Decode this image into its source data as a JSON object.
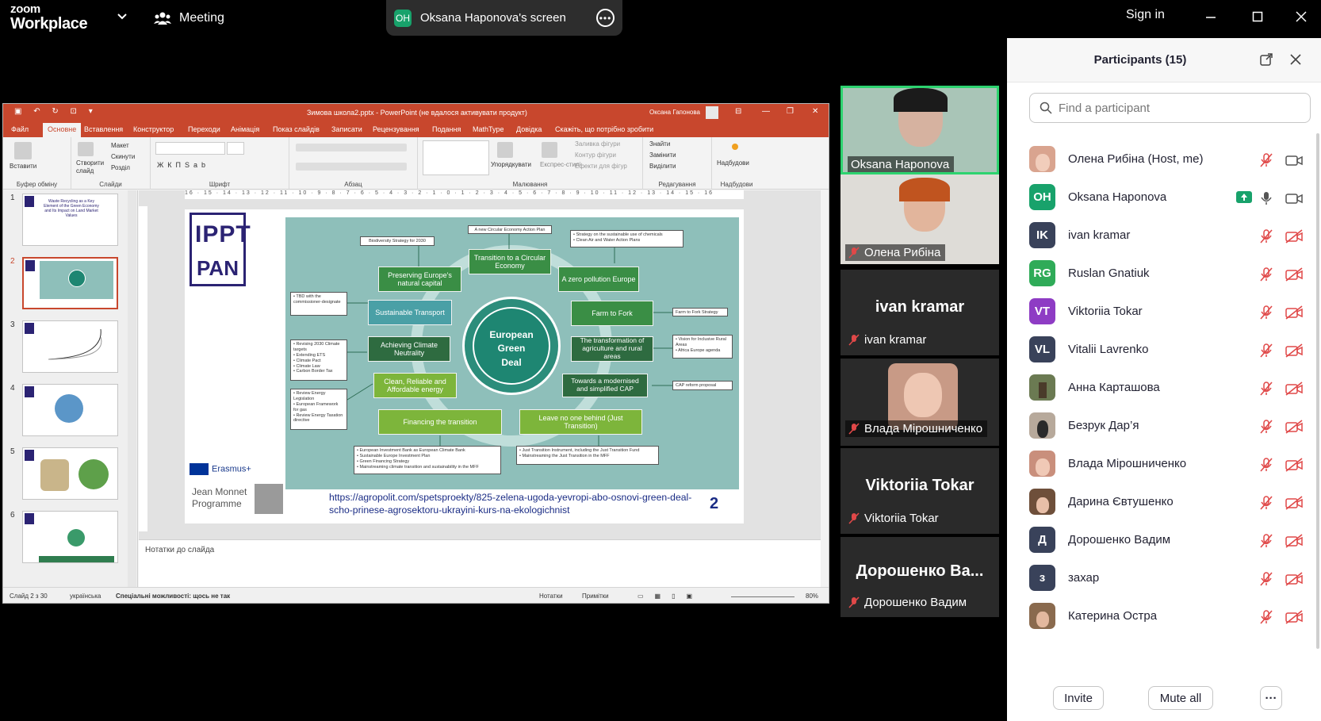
{
  "app": {
    "logo_line1": "zoom",
    "logo_line2": "Workplace",
    "meeting_label": "Meeting",
    "share_initials": "OH",
    "share_title": "Oksana Haponova's screen",
    "sign_in": "Sign in"
  },
  "ppt": {
    "window_title": "Зимова школа2.pptx - PowerPoint (не вдалося активувати продукт)",
    "user": "Оксана Гапонова",
    "tabs": [
      "Файл",
      "Основне",
      "Вставлення",
      "Конструктор",
      "Переходи",
      "Анімація",
      "Показ слайдів",
      "Записати",
      "Рецензування",
      "Подання",
      "MathType",
      "Довідка",
      "Скажіть, що потрібно зробити"
    ],
    "ribbon": {
      "paste": "Вставити",
      "clipboard": "Буфер обміну",
      "new_slide": "Створити слайд",
      "layout": "Макет",
      "reset": "Скинути",
      "section": "Розділ",
      "slides": "Слайди",
      "font": "Шрифт",
      "paragraph": "Абзац",
      "arrange": "Упорядкувати",
      "quick_styles": "Експрес-стилі",
      "shape_fill": "Заливка фігури",
      "shape_outline": "Контур фігури",
      "shape_effects": "Ефекти для фігур",
      "drawing": "Малювання",
      "find": "Знайти",
      "replace": "Замінити",
      "select": "Виділити",
      "editing": "Редагування",
      "addins_btn": "Надбудови",
      "addins": "Надбудови"
    },
    "ruler": "16 · 15 · 14 · 13 · 12 · 11 · 10 · 9 · 8 · 7 · 6 · 5 · 4 · 3 · 2 · 1 · 0 · 1 · 2 · 3 · 4 · 5 · 6 · 7 · 8 · 9 · 10 · 11 · 12 · 13 · 14 · 15 · 16",
    "thumb_numbers": [
      "1",
      "2",
      "3",
      "4",
      "5",
      "6"
    ],
    "thumb1_title": "Waste Recycling as a Key Element of the Green Economy and Its Impact on Land Market Values",
    "notes_placeholder": "Нотатки до слайда",
    "status": {
      "slide": "Слайд 2 з 30",
      "lang": "українська",
      "access": "Спеціальні можливості: щось не так",
      "notes": "Нотатки",
      "comments": "Примітки",
      "zoom": "80%"
    }
  },
  "slide": {
    "logo_top": "IPPT",
    "logo_bottom": "PAN",
    "center": [
      "European",
      "Green",
      "Deal"
    ],
    "green_boxes": {
      "transition": "Transition to a Circular Economy",
      "preserving": "Preserving Europe's natural capital",
      "zero_pollution": "A zero pollution Europe",
      "transport": "Sustainable Transport",
      "farm": "Farm to Fork",
      "climate": "Achieving Climate Neutrality",
      "agri": "The transformation of agriculture and rural areas",
      "energy": "Clean, Reliable and Affordable energy",
      "cap": "Towards a modernised and simplified CAP",
      "financing": "Financing the transition",
      "leave": "Leave no one behind (Just Transition)"
    },
    "white_boxes": {
      "circular_plan": "A new Circular Economy Action Plan",
      "biodiversity": "Biodiversity Strategy for 2030",
      "chemicals": "• Strategy on the sustainable use of chemicals\n• Clean Air and Water Action Plans",
      "tbd": "• TBD with the commissioner-designate",
      "f2f": "Farm to Fork Strategy",
      "revising": "• Revising 2030 Climate targets\n• Extending ETS\n• Climate Pact\n• Climate Law\n• Carbon Border Tax",
      "vision": "• Vision for Inclusive Rural Areas\n• Africa Europe agenda",
      "review": "• Review Energy Legislation\n• European Framework for gas\n• Review Energy Taxation directive",
      "cap_reform": "CAP reform proposal",
      "eib": "• European Investment Bank as European Climate Bank\n• Sustainable Europe Investment Plan\n• Green Financing Strategy\n• Mainstreaming climate transition and sustainability in the MFF",
      "jtf": "• Just Transition Instrument, including the Just Transition Fund\n• Mainstreaming the Just Transition in the MFF"
    },
    "erasmus": "Erasmus+",
    "jean_monnet": [
      "Jean Monnet",
      "Programme"
    ],
    "url": "https://agropolit.com/spetsproekty/825-zelena-ugoda-yevropi-abo-osnovi-green-deal-scho-prinese-agrosektoru-ukrayini-kurs-na-ekologichnist",
    "number": "2"
  },
  "videos": {
    "oksana": "Oksana Haponova",
    "olena": "Олена Рибіна",
    "ivan_big": "ivan kramar",
    "ivan": "ivan kramar",
    "vlada": "Влада Мірошниченко",
    "viktoriia_big": "Viktoriia Tokar",
    "viktoriia": "Viktoriia Tokar",
    "dorosh_big": "Дорошенко Ва...",
    "dorosh": "Дорошенко Вадим"
  },
  "panel": {
    "title": "Participants (15)",
    "search_placeholder": "Find a participant",
    "participants": [
      {
        "initials": "",
        "name": "Олена Рибіна (Host, me)",
        "color": "#d9a48f"
      },
      {
        "initials": "OH",
        "name": "Oksana Haponova",
        "color": "#18a26b"
      },
      {
        "initials": "IK",
        "name": " ivan kramar",
        "color": "#39425a"
      },
      {
        "initials": "RG",
        "name": "Ruslan Gnatiuk",
        "color": "#2fab58"
      },
      {
        "initials": "VT",
        "name": "Viktoriia Tokar",
        "color": "#8e3cc4"
      },
      {
        "initials": "VL",
        "name": "Vitalii Lavrenko",
        "color": "#39425a"
      },
      {
        "initials": "",
        "name": "Анна Карташова",
        "color": "#6b7a52"
      },
      {
        "initials": "",
        "name": "Безрук Дар’я",
        "color": "#b7a99b"
      },
      {
        "initials": "",
        "name": "Влада Мірошниченко",
        "color": "#c98f7c"
      },
      {
        "initials": "",
        "name": "Дарина Євтушенко",
        "color": "#6e4f3a"
      },
      {
        "initials": "Д",
        "name": "Дорошенко Вадим",
        "color": "#39425a"
      },
      {
        "initials": "з",
        "name": "захар",
        "color": "#39425a"
      },
      {
        "initials": "",
        "name": "Катерина Остра",
        "color": "#8a6a4e"
      }
    ],
    "invite": "Invite",
    "mute_all": "Mute all",
    "more": "···"
  }
}
